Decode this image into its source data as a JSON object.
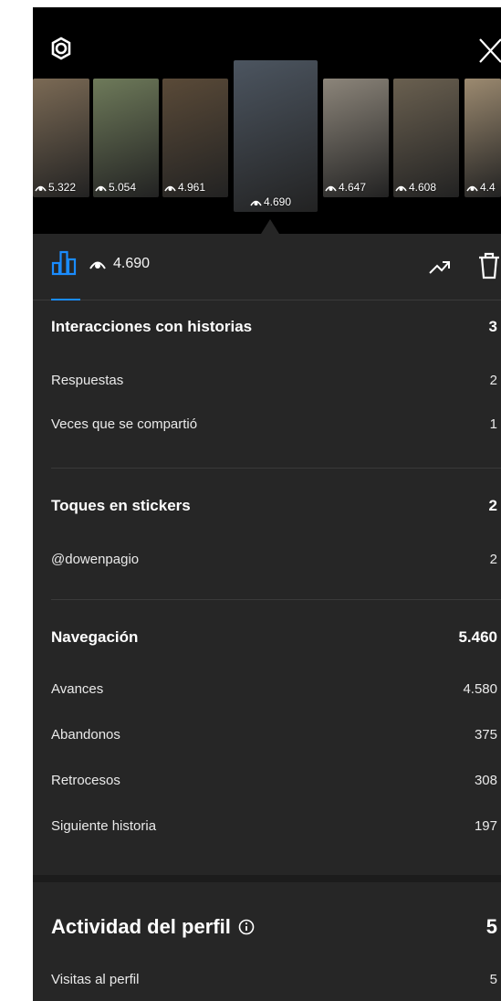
{
  "header": {
    "thumbnails": [
      {
        "views": "5.322",
        "color": "#7b6a55"
      },
      {
        "views": "5.054",
        "color": "#6e7a5a"
      },
      {
        "views": "4.961",
        "color": "#5a4a38"
      },
      {
        "views": "4.690",
        "color": "#4c5560",
        "selected": true
      },
      {
        "views": "4.647",
        "color": "#8c857a"
      },
      {
        "views": "4.608",
        "color": "#6a6050"
      },
      {
        "views": "4.4",
        "color": "#9c8a70"
      }
    ]
  },
  "toolbar": {
    "views": "4.690"
  },
  "sections": [
    {
      "title": "Interacciones con historias",
      "value": "3",
      "rows": [
        {
          "label": "Respuestas",
          "value": "2"
        },
        {
          "label": "Veces que se compartió",
          "value": "1"
        }
      ]
    },
    {
      "title": "Toques en stickers",
      "value": "2",
      "rows": [
        {
          "label": "@dowenpagio",
          "value": "2"
        }
      ]
    },
    {
      "title": "Navegación",
      "value": "5.460",
      "rows": [
        {
          "label": "Avances",
          "value": "4.580"
        },
        {
          "label": "Abandonos",
          "value": "375"
        },
        {
          "label": "Retrocesos",
          "value": "308"
        },
        {
          "label": "Siguiente historia",
          "value": "197"
        }
      ]
    }
  ],
  "profile": {
    "title": "Actividad del perfil",
    "value": "5",
    "rows": [
      {
        "label": "Visitas al perfil",
        "value": "5"
      }
    ]
  },
  "colors": {
    "accent": "#1a8cff",
    "background": "#262626"
  }
}
